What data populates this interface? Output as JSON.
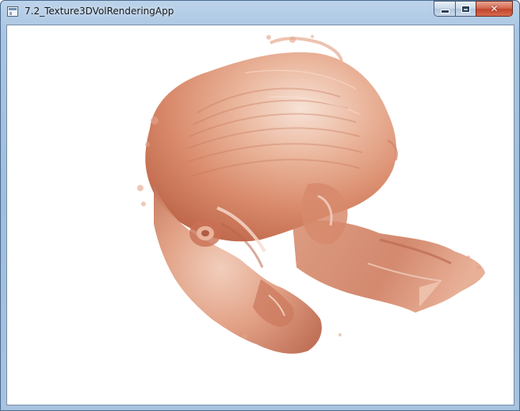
{
  "window": {
    "title": "7.2_Texture3DVolRenderingApp"
  },
  "controls": {
    "minimize_icon": "minimize-icon",
    "maximize_icon": "maximize-icon",
    "close_icon": "close-icon",
    "close_glyph": "✕"
  },
  "viewport": {
    "background": "#ffffff",
    "render_color_light": "#f2d3c4",
    "render_color_mid": "#e6a78a",
    "render_color_dark": "#b8644a"
  }
}
